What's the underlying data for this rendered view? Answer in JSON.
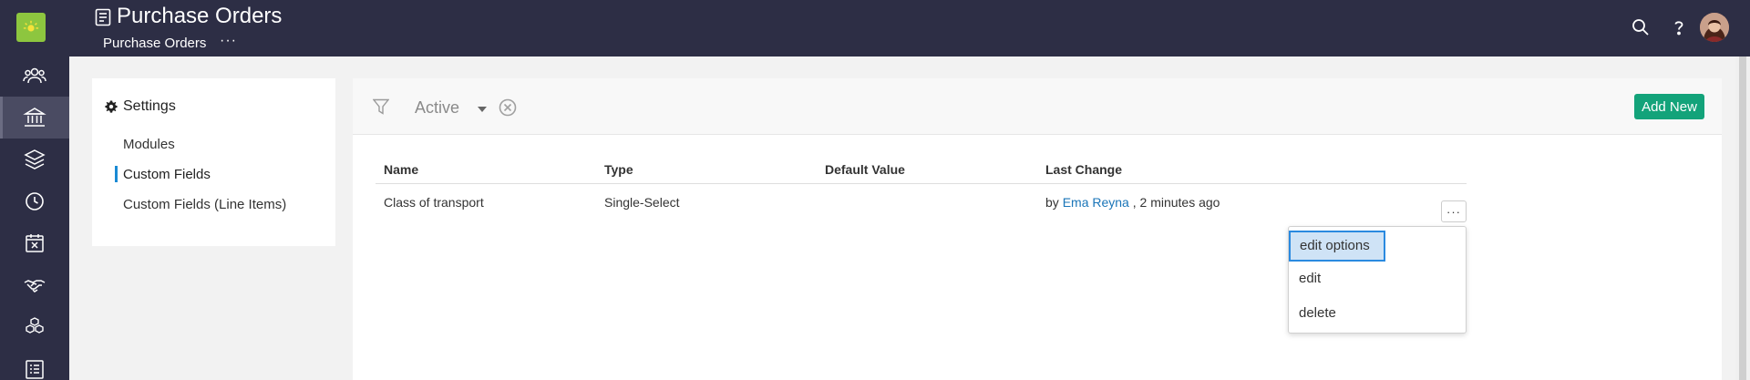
{
  "topbar": {
    "title": "Purchase Orders",
    "breadcrumb": "Purchase Orders",
    "breadcrumb_more": "···"
  },
  "rail": {
    "items": [
      "contacts-icon",
      "bank-icon",
      "layers-icon",
      "clock-icon",
      "calendar-icon",
      "handshake-icon",
      "boxes-icon",
      "list-icon"
    ],
    "active": "bank-icon"
  },
  "settings": {
    "heading": "Settings",
    "items": [
      {
        "label": "Modules"
      },
      {
        "label": "Custom Fields"
      },
      {
        "label": "Custom Fields (Line Items)"
      }
    ],
    "active": "Custom Fields"
  },
  "filter": {
    "status": "Active"
  },
  "actions": {
    "add_new": "Add New"
  },
  "table": {
    "columns": [
      "Name",
      "Type",
      "Default Value",
      "Last Change"
    ],
    "rows": [
      {
        "name": "Class of transport",
        "type": "Single-Select",
        "default_value": "",
        "last_change_prefix": "by ",
        "last_change_user": "Ema Reyna",
        "last_change_suffix": " , 2 minutes ago"
      }
    ],
    "row_more": "···"
  },
  "menu": {
    "items": [
      "edit options",
      "edit",
      "delete"
    ],
    "focused": "edit options"
  },
  "colors": {
    "navbar": "#2d2e45",
    "accent_green": "#13a37a",
    "link_blue": "#1a75b8",
    "logo_green": "#8dc63f"
  }
}
